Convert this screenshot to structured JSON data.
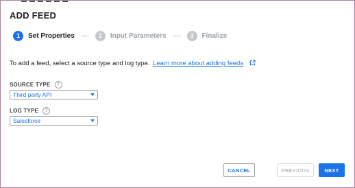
{
  "dialog": {
    "title": "ADD FEED",
    "steps": [
      {
        "number": "1",
        "label": "Set Properties",
        "state": "active"
      },
      {
        "number": "2",
        "label": "Input Parameters",
        "state": "inactive"
      },
      {
        "number": "3",
        "label": "Finalize",
        "state": "inactive"
      }
    ],
    "description": "To add a feed, select a source type and log type.",
    "learn_more_link": "Learn more about adding feeds",
    "source_type": {
      "label": "SOURCE TYPE",
      "value": "Third party API"
    },
    "log_type": {
      "label": "LOG TYPE",
      "value": "Salesforce"
    },
    "buttons": {
      "cancel": "CANCEL",
      "previous": "PREVIOUS",
      "next": "NEXT"
    }
  },
  "colors": {
    "accent": "#1a73e8",
    "inactive_step": "#c4c7cc",
    "border": "#a8809a"
  },
  "icons": {
    "external_link": "external-link-icon",
    "help": "help-circle-icon",
    "dropdown": "chevron-down-icon"
  }
}
